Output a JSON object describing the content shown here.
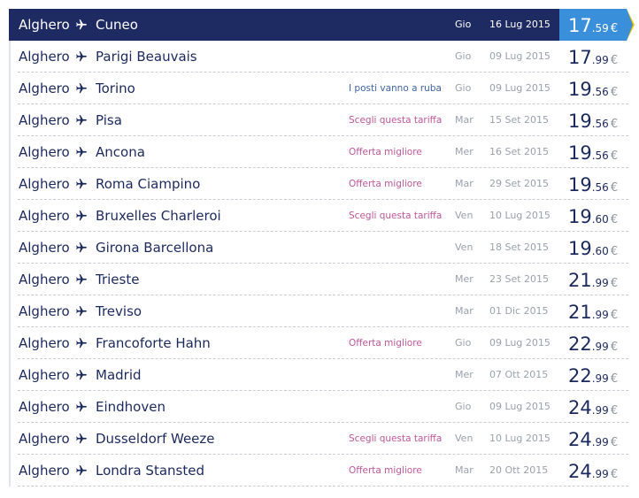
{
  "flights": [
    {
      "origin": "Alghero",
      "destination": "Cuneo",
      "promo": "",
      "promo_style": "",
      "day": "Gio",
      "date": "16 Lug 2015",
      "price_int": "17",
      "price_dec": ".59",
      "currency": "€",
      "selected": true
    },
    {
      "origin": "Alghero",
      "destination": "Parigi Beauvais",
      "promo": "",
      "promo_style": "",
      "day": "Gio",
      "date": "09 Lug 2015",
      "price_int": "17",
      "price_dec": ".99",
      "currency": "€",
      "selected": false
    },
    {
      "origin": "Alghero",
      "destination": "Torino",
      "promo": "I posti vanno a ruba",
      "promo_style": "blue",
      "day": "Gio",
      "date": "09 Lug 2015",
      "price_int": "19",
      "price_dec": ".56",
      "currency": "€",
      "selected": false
    },
    {
      "origin": "Alghero",
      "destination": "Pisa",
      "promo": "Scegli questa tariffa",
      "promo_style": "pink",
      "day": "Mar",
      "date": "15 Set 2015",
      "price_int": "19",
      "price_dec": ".56",
      "currency": "€",
      "selected": false
    },
    {
      "origin": "Alghero",
      "destination": "Ancona",
      "promo": "Offerta migliore",
      "promo_style": "pink",
      "day": "Mer",
      "date": "16 Set 2015",
      "price_int": "19",
      "price_dec": ".56",
      "currency": "€",
      "selected": false
    },
    {
      "origin": "Alghero",
      "destination": "Roma Ciampino",
      "promo": "Offerta migliore",
      "promo_style": "pink",
      "day": "Mar",
      "date": "29 Set 2015",
      "price_int": "19",
      "price_dec": ".56",
      "currency": "€",
      "selected": false
    },
    {
      "origin": "Alghero",
      "destination": "Bruxelles Charleroi",
      "promo": "Scegli questa tariffa",
      "promo_style": "pink",
      "day": "Ven",
      "date": "10 Lug 2015",
      "price_int": "19",
      "price_dec": ".60",
      "currency": "€",
      "selected": false
    },
    {
      "origin": "Alghero",
      "destination": "Girona Barcellona",
      "promo": "",
      "promo_style": "",
      "day": "Ven",
      "date": "18 Set 2015",
      "price_int": "19",
      "price_dec": ".60",
      "currency": "€",
      "selected": false
    },
    {
      "origin": "Alghero",
      "destination": "Trieste",
      "promo": "",
      "promo_style": "",
      "day": "Mer",
      "date": "23 Set 2015",
      "price_int": "21",
      "price_dec": ".99",
      "currency": "€",
      "selected": false
    },
    {
      "origin": "Alghero",
      "destination": "Treviso",
      "promo": "",
      "promo_style": "",
      "day": "Mar",
      "date": "01 Dic 2015",
      "price_int": "21",
      "price_dec": ".99",
      "currency": "€",
      "selected": false
    },
    {
      "origin": "Alghero",
      "destination": "Francoforte Hahn",
      "promo": "Offerta migliore",
      "promo_style": "pink",
      "day": "Gio",
      "date": "09 Lug 2015",
      "price_int": "22",
      "price_dec": ".99",
      "currency": "€",
      "selected": false
    },
    {
      "origin": "Alghero",
      "destination": "Madrid",
      "promo": "",
      "promo_style": "",
      "day": "Mer",
      "date": "07 Ott 2015",
      "price_int": "22",
      "price_dec": ".99",
      "currency": "€",
      "selected": false
    },
    {
      "origin": "Alghero",
      "destination": "Eindhoven",
      "promo": "",
      "promo_style": "",
      "day": "Gio",
      "date": "09 Lug 2015",
      "price_int": "24",
      "price_dec": ".99",
      "currency": "€",
      "selected": false
    },
    {
      "origin": "Alghero",
      "destination": "Dusseldorf Weeze",
      "promo": "Scegli questa tariffa",
      "promo_style": "pink",
      "day": "Ven",
      "date": "10 Lug 2015",
      "price_int": "24",
      "price_dec": ".99",
      "currency": "€",
      "selected": false
    },
    {
      "origin": "Alghero",
      "destination": "Londra Stansted",
      "promo": "Offerta migliore",
      "promo_style": "pink",
      "day": "Mar",
      "date": "20 Ott 2015",
      "price_int": "24",
      "price_dec": ".99",
      "currency": "€",
      "selected": false
    }
  ],
  "colors": {
    "selected_bg": "#1e2b63",
    "price_box": "#3a8fdb",
    "accent_chevron": "#f3c300",
    "text_navy": "#1b2a5e",
    "promo_pink": "#c0569a",
    "promo_blue": "#3f63a8"
  },
  "icons": {
    "route": "plane-icon"
  }
}
